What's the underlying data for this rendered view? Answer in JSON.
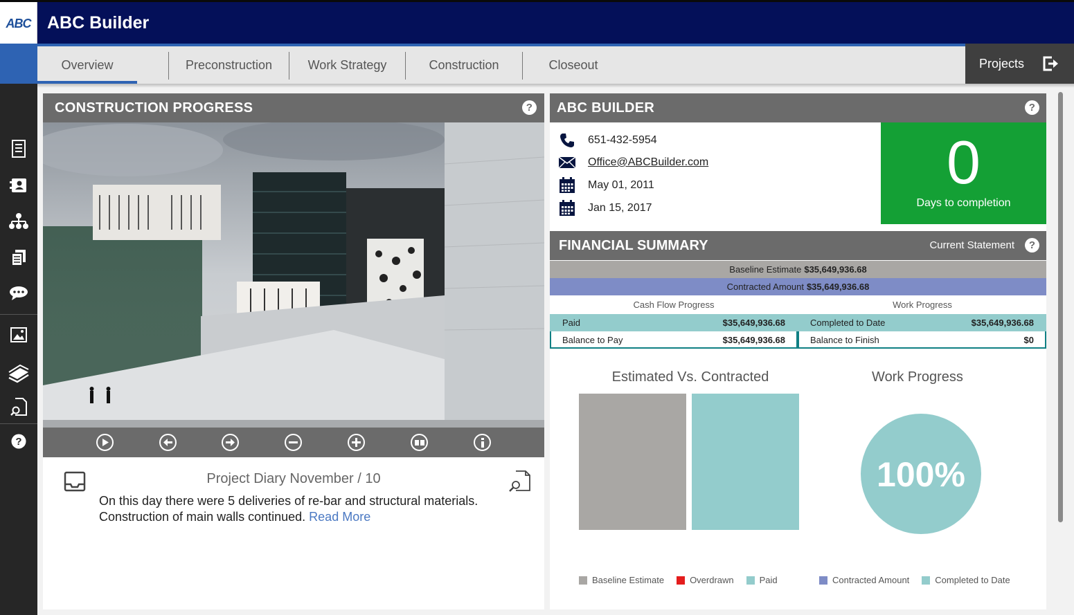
{
  "app": {
    "title": "ABC Builder",
    "logo_text": "ABC"
  },
  "tabs": [
    {
      "label": "Overview"
    },
    {
      "label": "Preconstruction"
    },
    {
      "label": "Work Strategy"
    },
    {
      "label": "Construction"
    },
    {
      "label": "Closeout"
    }
  ],
  "projects_label": "Projects",
  "sidebar_icons": [
    "document-icon",
    "contact-card-icon",
    "org-chart-icon",
    "files-icon",
    "chat-icon",
    "image-icon",
    "layers-icon",
    "file-search-icon",
    "help-icon"
  ],
  "progress_panel": {
    "title": "CONSTRUCTION PROGRESS",
    "help": "?",
    "controls": [
      "play-icon",
      "previous-icon",
      "next-icon",
      "zoom-out-icon",
      "zoom-in-icon",
      "fullscreen-icon",
      "info-icon"
    ],
    "diary_title": "Project Diary November / 10",
    "diary_text": "On this day there were 5 deliveries of re-bar and structural materials. Construction of main walls continued.",
    "read_more": "Read More"
  },
  "builder_panel": {
    "title": "ABC BUILDER",
    "help": "?",
    "phone": "651-432-5954",
    "email": "Office@ABCBuilder.com",
    "start_date": "May 01, 2011",
    "end_date": "Jan 15, 2017",
    "days_value": "0",
    "days_label": "Days to completion"
  },
  "financial": {
    "title": "FINANCIAL SUMMARY",
    "statement_label": "Current Statement",
    "help": "?",
    "baseline_label": "Baseline Estimate",
    "baseline_value": "$35,649,936.68",
    "contracted_label": "Contracted Amount",
    "contracted_value": "$35,649,936.68",
    "cash_flow_title": "Cash Flow Progress",
    "work_progress_title": "Work Progress",
    "paid_label": "Paid",
    "paid_value": "$35,649,936.68",
    "balance_pay_label": "Balance to Pay",
    "balance_pay_value": "$35,649,936.68",
    "completed_label": "Completed to Date",
    "completed_value": "$35,649,936.68",
    "balance_finish_label": "Balance to Finish",
    "balance_finish_value": "$0"
  },
  "colors": {
    "header_navy": "#041059",
    "accent_blue": "#2e63b3",
    "panel_gray": "#6b6b6b",
    "green": "#14a035",
    "teal": "#93cccc",
    "baseline_gray": "#a9a7a4",
    "contracted_blue": "#7e8cc6",
    "overdrawn_red": "#e41d1d"
  },
  "chart_data": [
    {
      "type": "bar",
      "title": "Estimated Vs. Contracted",
      "categories": [
        "Baseline Estimate",
        "Paid"
      ],
      "values": [
        35649936.68,
        35649936.68
      ],
      "legend": [
        "Baseline Estimate",
        "Overdrawn",
        "Paid"
      ],
      "legend_colors": [
        "#a9a7a4",
        "#e41d1d",
        "#93cccc"
      ],
      "ylim": [
        0,
        35649936.68
      ]
    },
    {
      "type": "pie",
      "title": "Work Progress",
      "center_label": "100%",
      "value": 100,
      "legend": [
        "Contracted Amount",
        "Completed to Date"
      ],
      "legend_colors": [
        "#7e8cc6",
        "#93cccc"
      ]
    }
  ]
}
